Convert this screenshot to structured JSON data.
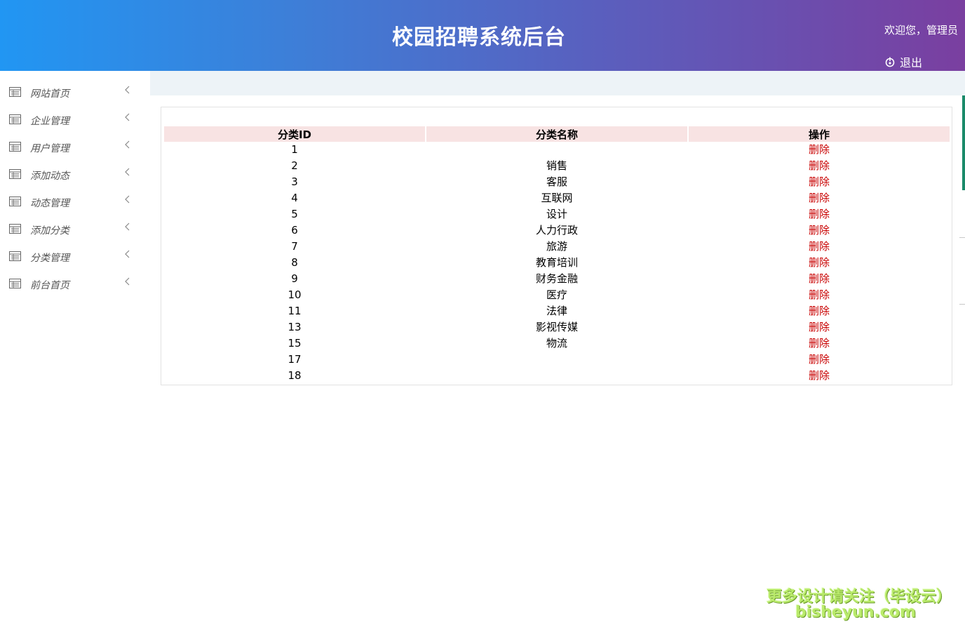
{
  "header": {
    "title": "校园招聘系统后台",
    "welcome": "欢迎您，管理员",
    "logout_label": "退出",
    "colors": {
      "gradient_start": "#2196f3",
      "gradient_end": "#7a3fa0"
    }
  },
  "sidebar": {
    "items": [
      {
        "label": "网站首页",
        "icon": "list-icon",
        "chevron": "chevron-left-icon"
      },
      {
        "label": "企业管理",
        "icon": "list-icon",
        "chevron": "chevron-left-icon"
      },
      {
        "label": "用户管理",
        "icon": "list-icon",
        "chevron": "chevron-left-icon"
      },
      {
        "label": "添加动态",
        "icon": "list-icon",
        "chevron": "chevron-left-icon"
      },
      {
        "label": "动态管理",
        "icon": "list-icon",
        "chevron": "chevron-left-icon"
      },
      {
        "label": "添加分类",
        "icon": "list-icon",
        "chevron": "chevron-left-icon"
      },
      {
        "label": "分类管理",
        "icon": "list-icon",
        "chevron": "chevron-left-icon"
      },
      {
        "label": "前台首页",
        "icon": "list-icon",
        "chevron": "chevron-left-icon"
      }
    ]
  },
  "table": {
    "headers": [
      "分类ID",
      "分类名称",
      "操作"
    ],
    "rows": [
      {
        "id": "1",
        "name": "",
        "action": "删除"
      },
      {
        "id": "2",
        "name": "销售",
        "action": "删除"
      },
      {
        "id": "3",
        "name": "客服",
        "action": "删除"
      },
      {
        "id": "4",
        "name": "互联网",
        "action": "删除"
      },
      {
        "id": "5",
        "name": "设计",
        "action": "删除"
      },
      {
        "id": "6",
        "name": "人力行政",
        "action": "删除"
      },
      {
        "id": "7",
        "name": "旅游",
        "action": "删除"
      },
      {
        "id": "8",
        "name": "教育培训",
        "action": "删除"
      },
      {
        "id": "9",
        "name": "财务金融",
        "action": "删除"
      },
      {
        "id": "10",
        "name": "医疗",
        "action": "删除"
      },
      {
        "id": "11",
        "name": "法律",
        "action": "删除"
      },
      {
        "id": "13",
        "name": "影视传媒",
        "action": "删除"
      },
      {
        "id": "15",
        "name": "物流",
        "action": "删除"
      },
      {
        "id": "17",
        "name": "",
        "action": "删除"
      },
      {
        "id": "18",
        "name": "",
        "action": "删除"
      }
    ],
    "colors": {
      "header_bg": "#f8e3e3",
      "action_link": "#c80000"
    }
  },
  "watermark": {
    "line1": "更多设计请关注（毕设云）",
    "line2": "bisheyun.com"
  }
}
